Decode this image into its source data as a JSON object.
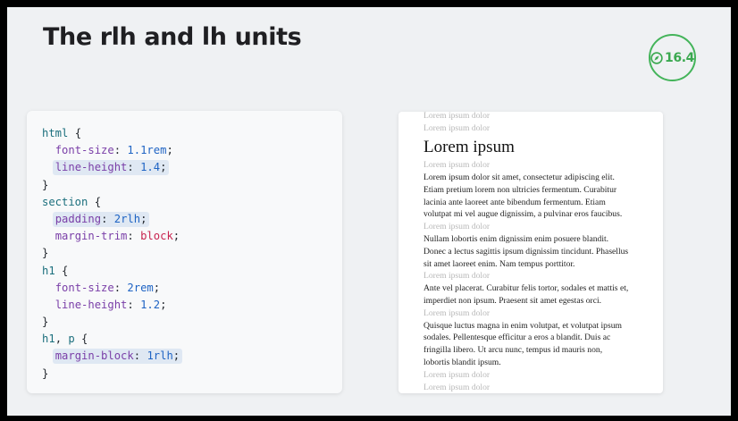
{
  "slide": {
    "title": "The rlh and lh units",
    "badge": {
      "icon": "safari-compass-icon",
      "version": "16.4",
      "color": "#44b45a"
    }
  },
  "code": {
    "lines": [
      {
        "hl": false,
        "indent": "",
        "tokens": [
          {
            "t": "sel",
            "v": "html"
          },
          {
            "t": "punc",
            "v": " {"
          }
        ]
      },
      {
        "hl": false,
        "indent": "  ",
        "tokens": [
          {
            "t": "prop",
            "v": "font-size"
          },
          {
            "t": "punc",
            "v": ": "
          },
          {
            "t": "num",
            "v": "1.1rem"
          },
          {
            "t": "punc",
            "v": ";"
          }
        ]
      },
      {
        "hl": true,
        "indent": "  ",
        "tokens": [
          {
            "t": "prop",
            "v": "line-height"
          },
          {
            "t": "punc",
            "v": ": "
          },
          {
            "t": "num",
            "v": "1.4"
          },
          {
            "t": "punc",
            "v": ";"
          }
        ]
      },
      {
        "hl": false,
        "indent": "",
        "tokens": [
          {
            "t": "punc",
            "v": "}"
          }
        ]
      },
      {
        "hl": false,
        "indent": "",
        "tokens": [
          {
            "t": "sel",
            "v": "section"
          },
          {
            "t": "punc",
            "v": " {"
          }
        ]
      },
      {
        "hl": true,
        "indent": "  ",
        "tokens": [
          {
            "t": "prop",
            "v": "padding"
          },
          {
            "t": "punc",
            "v": ": "
          },
          {
            "t": "num",
            "v": "2rlh"
          },
          {
            "t": "punc",
            "v": ";"
          }
        ]
      },
      {
        "hl": false,
        "indent": "  ",
        "tokens": [
          {
            "t": "prop",
            "v": "margin-trim"
          },
          {
            "t": "punc",
            "v": ": "
          },
          {
            "t": "kw",
            "v": "block"
          },
          {
            "t": "punc",
            "v": ";"
          }
        ]
      },
      {
        "hl": false,
        "indent": "",
        "tokens": [
          {
            "t": "punc",
            "v": "}"
          }
        ]
      },
      {
        "hl": false,
        "indent": "",
        "tokens": [
          {
            "t": "sel",
            "v": "h1"
          },
          {
            "t": "punc",
            "v": " {"
          }
        ]
      },
      {
        "hl": false,
        "indent": "  ",
        "tokens": [
          {
            "t": "prop",
            "v": "font-size"
          },
          {
            "t": "punc",
            "v": ": "
          },
          {
            "t": "num",
            "v": "2rem"
          },
          {
            "t": "punc",
            "v": ";"
          }
        ]
      },
      {
        "hl": false,
        "indent": "  ",
        "tokens": [
          {
            "t": "prop",
            "v": "line-height"
          },
          {
            "t": "punc",
            "v": ": "
          },
          {
            "t": "num",
            "v": "1.2"
          },
          {
            "t": "punc",
            "v": ";"
          }
        ]
      },
      {
        "hl": false,
        "indent": "",
        "tokens": [
          {
            "t": "punc",
            "v": "}"
          }
        ]
      },
      {
        "hl": false,
        "indent": "",
        "tokens": [
          {
            "t": "sel",
            "v": "h1"
          },
          {
            "t": "punc",
            "v": ", "
          },
          {
            "t": "sel",
            "v": "p"
          },
          {
            "t": "punc",
            "v": " {"
          }
        ]
      },
      {
        "hl": true,
        "indent": "  ",
        "tokens": [
          {
            "t": "prop",
            "v": "margin-block"
          },
          {
            "t": "punc",
            "v": ": "
          },
          {
            "t": "num",
            "v": "1rlh"
          },
          {
            "t": "punc",
            "v": ";"
          }
        ]
      },
      {
        "hl": false,
        "indent": "",
        "tokens": [
          {
            "t": "punc",
            "v": "}"
          }
        ]
      }
    ],
    "colors": {
      "selector": "#1b6f7d",
      "property": "#7a3fa8",
      "number": "#1f64c4",
      "keyword": "#c8234f",
      "highlight": "#dfe8f3"
    }
  },
  "preview": {
    "blocks": [
      {
        "type": "ghost",
        "text": "Lorem ipsum dolor"
      },
      {
        "type": "ghost",
        "text": "Lorem ipsum dolor"
      },
      {
        "type": "h1",
        "text": "Lorem ipsum"
      },
      {
        "type": "ghost",
        "text": "Lorem ipsum dolor"
      },
      {
        "type": "p",
        "lines": [
          "Lorem ipsum dolor sit amet, consectetur adipiscing elit.",
          "Etiam pretium lorem non ultricies fermentum. Curabitur",
          "lacinia ante laoreet ante bibendum fermentum. Etiam",
          "volutpat mi vel augue dignissim, a pulvinar eros faucibus."
        ]
      },
      {
        "type": "ghost",
        "text": "Lorem ipsum dolor"
      },
      {
        "type": "p",
        "lines": [
          "Nullam lobortis enim dignissim enim posuere blandit.",
          "Donec a lectus sagittis ipsum dignissim tincidunt. Phasellus",
          "sit amet laoreet enim. Nam tempus porttitor."
        ]
      },
      {
        "type": "ghost",
        "text": "Lorem ipsum dolor"
      },
      {
        "type": "p",
        "lines": [
          "Ante vel placerat. Curabitur felis tortor, sodales et mattis et,",
          "imperdiet non ipsum. Praesent sit amet egestas orci."
        ]
      },
      {
        "type": "ghost",
        "text": "Lorem ipsum dolor"
      },
      {
        "type": "p",
        "lines": [
          "Quisque luctus magna in enim volutpat, et volutpat ipsum",
          "sodales. Pellentesque efficitur a eros a blandit. Duis ac",
          "fringilla libero. Ut arcu nunc, tempus id mauris non,",
          "lobortis blandit ipsum."
        ]
      },
      {
        "type": "ghost",
        "text": "Lorem ipsum dolor"
      },
      {
        "type": "ghost",
        "text": "Lorem ipsum dolor"
      }
    ]
  }
}
